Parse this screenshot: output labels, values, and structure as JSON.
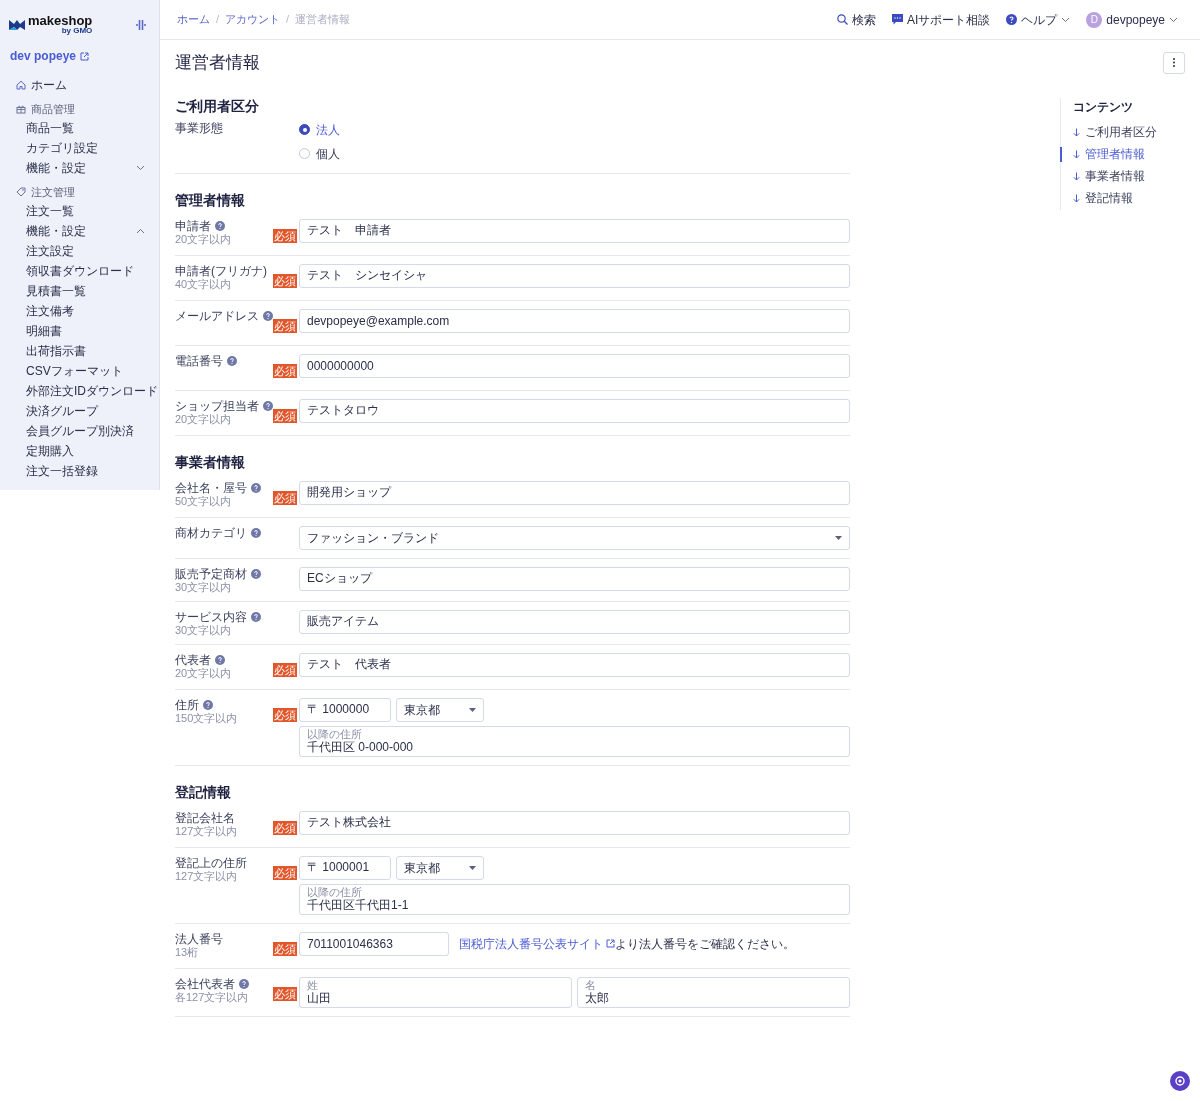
{
  "sidebar": {
    "logo": "makeshop",
    "logo_sub": "by GMO",
    "shop": "dev popeye",
    "items": [
      {
        "kind": "link",
        "label": "ホーム"
      },
      {
        "kind": "group",
        "label": "商品管理",
        "children": [
          {
            "label": "商品一覧"
          },
          {
            "label": "カテゴリ設定"
          },
          {
            "label": "機能・設定",
            "expanded": false
          }
        ]
      },
      {
        "kind": "group",
        "label": "注文管理",
        "children": [
          {
            "label": "注文一覧"
          },
          {
            "label": "機能・設定",
            "expanded": true,
            "children": [
              {
                "label": "注文設定"
              },
              {
                "label": "領収書ダウンロード"
              },
              {
                "label": "見積書一覧"
              },
              {
                "label": "注文備考"
              },
              {
                "label": "明細書"
              },
              {
                "label": "出荷指示書"
              },
              {
                "label": "CSVフォーマット"
              },
              {
                "label": "外部注文IDダウンロード"
              },
              {
                "label": "決済グループ"
              },
              {
                "label": "会員グループ別決済"
              },
              {
                "label": "定期購入"
              },
              {
                "label": "注文一括登録"
              }
            ]
          }
        ]
      }
    ]
  },
  "breadcrumbs": [
    {
      "kind": "link",
      "label": "ホーム",
      "current": false
    },
    {
      "kind": "separator",
      "label": "/"
    },
    {
      "kind": "link",
      "label": "アカウント",
      "current": false
    },
    {
      "kind": "separator",
      "label": "/"
    },
    {
      "kind": "link",
      "label": "運営者情報",
      "current": true
    }
  ],
  "header_actions": [
    {
      "kind": "search",
      "label": "検索"
    },
    {
      "kind": "chat",
      "label": "AIサポート相談"
    },
    {
      "kind": "help",
      "label": "ヘルプ"
    },
    {
      "kind": "user",
      "avatar": "D",
      "label": "devpopeye"
    }
  ],
  "page_title": "運営者情報",
  "toc": {
    "title": "コンテンツ",
    "items": [
      {
        "label": "ご利用者区分",
        "selected": false
      },
      {
        "label": "管理者情報",
        "selected": true
      },
      {
        "label": "事業者情報",
        "selected": false
      },
      {
        "label": "登記情報",
        "selected": false
      }
    ]
  },
  "sections": [
    {
      "title": "ご利用者区分",
      "rows": [
        {
          "kind": "radio",
          "label": "事業形態",
          "options": [
            {
              "label": "法人",
              "selected": true
            },
            {
              "label": "個人",
              "selected": false
            }
          ]
        }
      ]
    },
    {
      "title": "管理者情報",
      "rows": [
        {
          "kind": "text",
          "label": "申請者",
          "help": true,
          "hint": "20文字以内",
          "badge": "必須",
          "value": "テスト　申請者"
        },
        {
          "kind": "text",
          "label": "申請者(フリガナ)",
          "help": false,
          "hint": "40文字以内",
          "badge": "必須",
          "value": "テスト　シンセイシャ"
        },
        {
          "kind": "text",
          "label": "メールアドレス",
          "help": true,
          "badge": "必須",
          "value": "devpopeye@example.com"
        },
        {
          "kind": "text",
          "label": "電話番号",
          "help": true,
          "badge": "必須",
          "value": "0000000000"
        },
        {
          "kind": "text",
          "label": "ショップ担当者",
          "help": true,
          "hint": "20文字以内",
          "badge": "必須",
          "value": "テストタロウ"
        }
      ]
    },
    {
      "title": "事業者情報",
      "rows": [
        {
          "kind": "text",
          "label": "会社名・屋号",
          "help": true,
          "hint": "50文字以内",
          "badge": "必須",
          "value": "開発用ショップ"
        },
        {
          "kind": "select",
          "label": "商材カテゴリ",
          "help": true,
          "value": "ファッション・ブランド"
        },
        {
          "kind": "text",
          "label": "販売予定商材",
          "help": true,
          "hint": "30文字以内",
          "value": "ECショップ"
        },
        {
          "kind": "text",
          "label": "サービス内容",
          "help": true,
          "hint": "30文字以内",
          "value": "販売アイテム"
        },
        {
          "kind": "text",
          "label": "代表者",
          "help": true,
          "hint": "20文字以内",
          "badge": "必須",
          "value": "テスト　代表者"
        },
        {
          "kind": "address",
          "label": "住所",
          "help": true,
          "hint": "150文字以内",
          "badge": "必須",
          "zip": "〒 1000000",
          "prefecture": "東京都",
          "rest_label": "以降の住所",
          "rest": "千代田区 0-000-000"
        }
      ]
    },
    {
      "title": "登記情報",
      "rows": [
        {
          "kind": "text",
          "label": "登記会社名",
          "help": false,
          "hint": "127文字以内",
          "badge": "必須",
          "value": "テスト株式会社"
        },
        {
          "kind": "address",
          "label": "登記上の住所",
          "help": false,
          "hint": "127文字以内",
          "badge": "必須",
          "zip": "〒 1000001",
          "prefecture": "東京都",
          "rest_label": "以降の住所",
          "rest": "千代田区千代田1-1"
        },
        {
          "kind": "corp_number",
          "label": "法人番号",
          "help": false,
          "hint": "13桁",
          "badge": "必須",
          "value": "7011001046363",
          "link": "国税庁法人番号公表サイト",
          "after": "より法人番号をご確認ください。"
        },
        {
          "kind": "name_pair",
          "label": "会社代表者",
          "help": true,
          "hint": "各127文字以内",
          "badge": "必須",
          "fields": [
            {
              "label": "姓",
              "value": "山田"
            },
            {
              "label": "名",
              "value": "太郎"
            }
          ]
        }
      ]
    }
  ]
}
